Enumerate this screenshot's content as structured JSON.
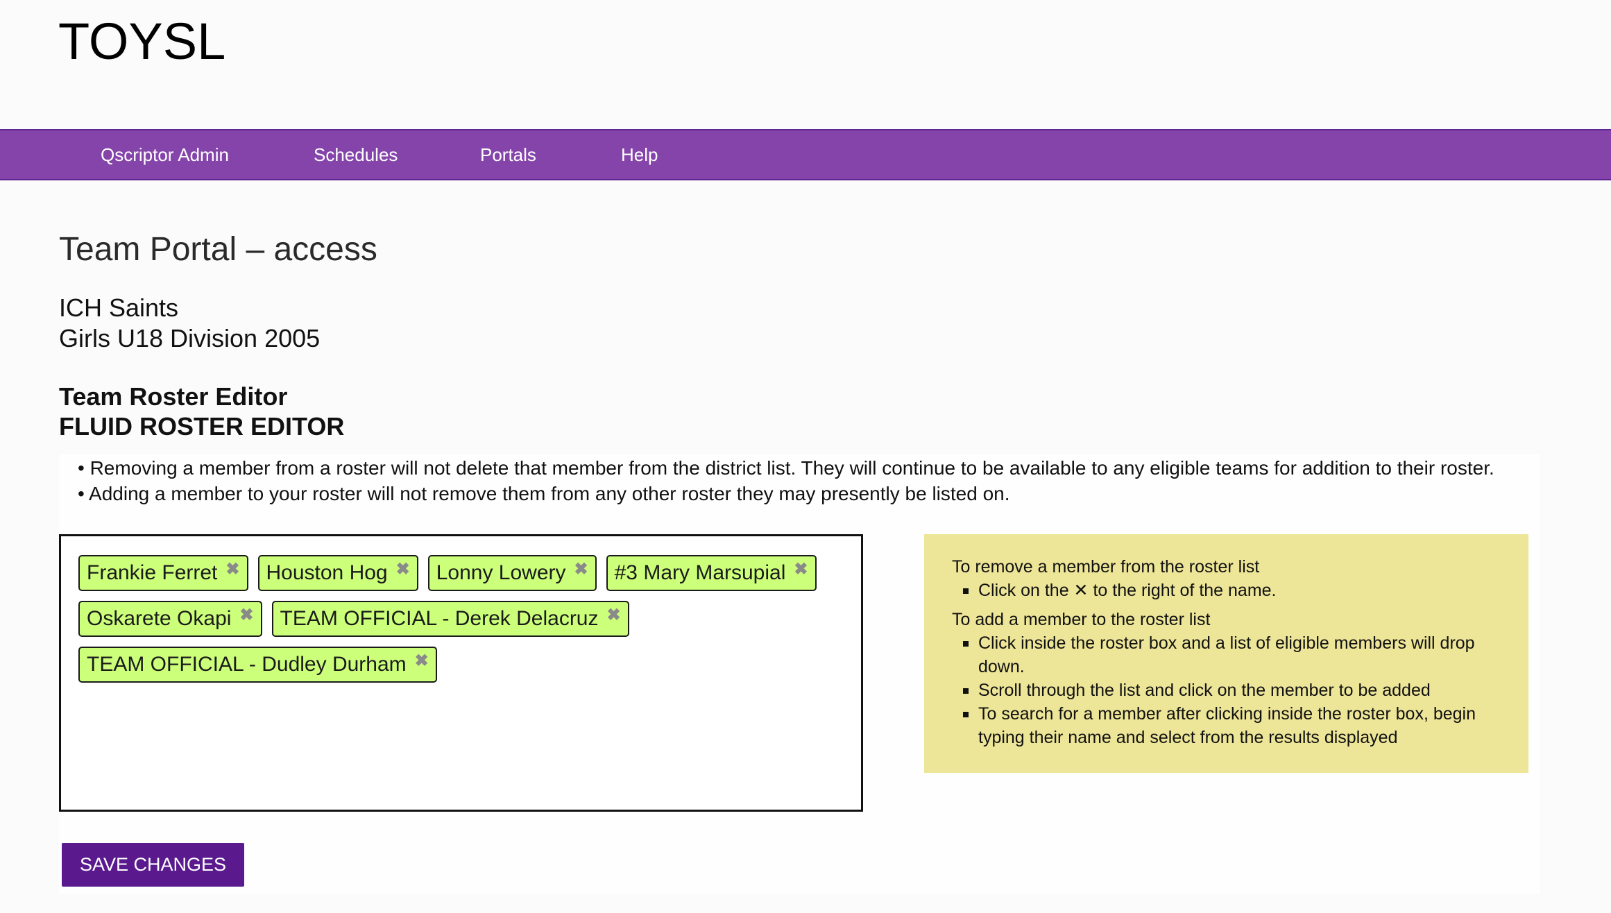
{
  "site": {
    "title": "TOYSL"
  },
  "nav": {
    "items": [
      {
        "label": "Qscriptor Admin"
      },
      {
        "label": "Schedules"
      },
      {
        "label": "Portals"
      },
      {
        "label": "Help"
      }
    ]
  },
  "page": {
    "title": "Team Portal – access",
    "team_name": "ICH Saints",
    "division": "Girls U18 Division 2005",
    "editor_title": "Team Roster Editor",
    "editor_subtitle": "FLUID ROSTER EDITOR"
  },
  "notes": [
    "• Removing a member from a roster will not delete that member from the district list. They will continue to be available to any eligible teams for addition to their roster.",
    "• Adding a member to your roster will not remove them from any other roster they may presently be listed on."
  ],
  "roster": {
    "members": [
      {
        "name": "Frankie Ferret"
      },
      {
        "name": "Houston Hog"
      },
      {
        "name": "Lonny Lowery"
      },
      {
        "name": "#3 Mary Marsupial"
      },
      {
        "name": "Oskarete Okapi"
      },
      {
        "name": "TEAM OFFICIAL - Derek Delacruz"
      },
      {
        "name": "TEAM OFFICIAL - Dudley Durham"
      }
    ],
    "remove_glyph": "✖"
  },
  "help": {
    "remove_heading": "To remove a member from the roster list",
    "remove_steps": [
      "Click on the ✕ to the right of the name."
    ],
    "add_heading": "To add a member to the roster list",
    "add_steps": [
      "Click inside the roster box and a list of eligible members will drop down.",
      "Scroll through the list and click on the member to be added",
      "To search for a member after clicking inside the roster box, begin typing their name and select from the results displayed"
    ]
  },
  "actions": {
    "save_label": "SAVE CHANGES"
  },
  "colors": {
    "nav_bg": "#8544aa",
    "tag_bg": "#ccff7a",
    "help_bg": "#ede597",
    "save_button_bg": "#5a1a8e"
  }
}
